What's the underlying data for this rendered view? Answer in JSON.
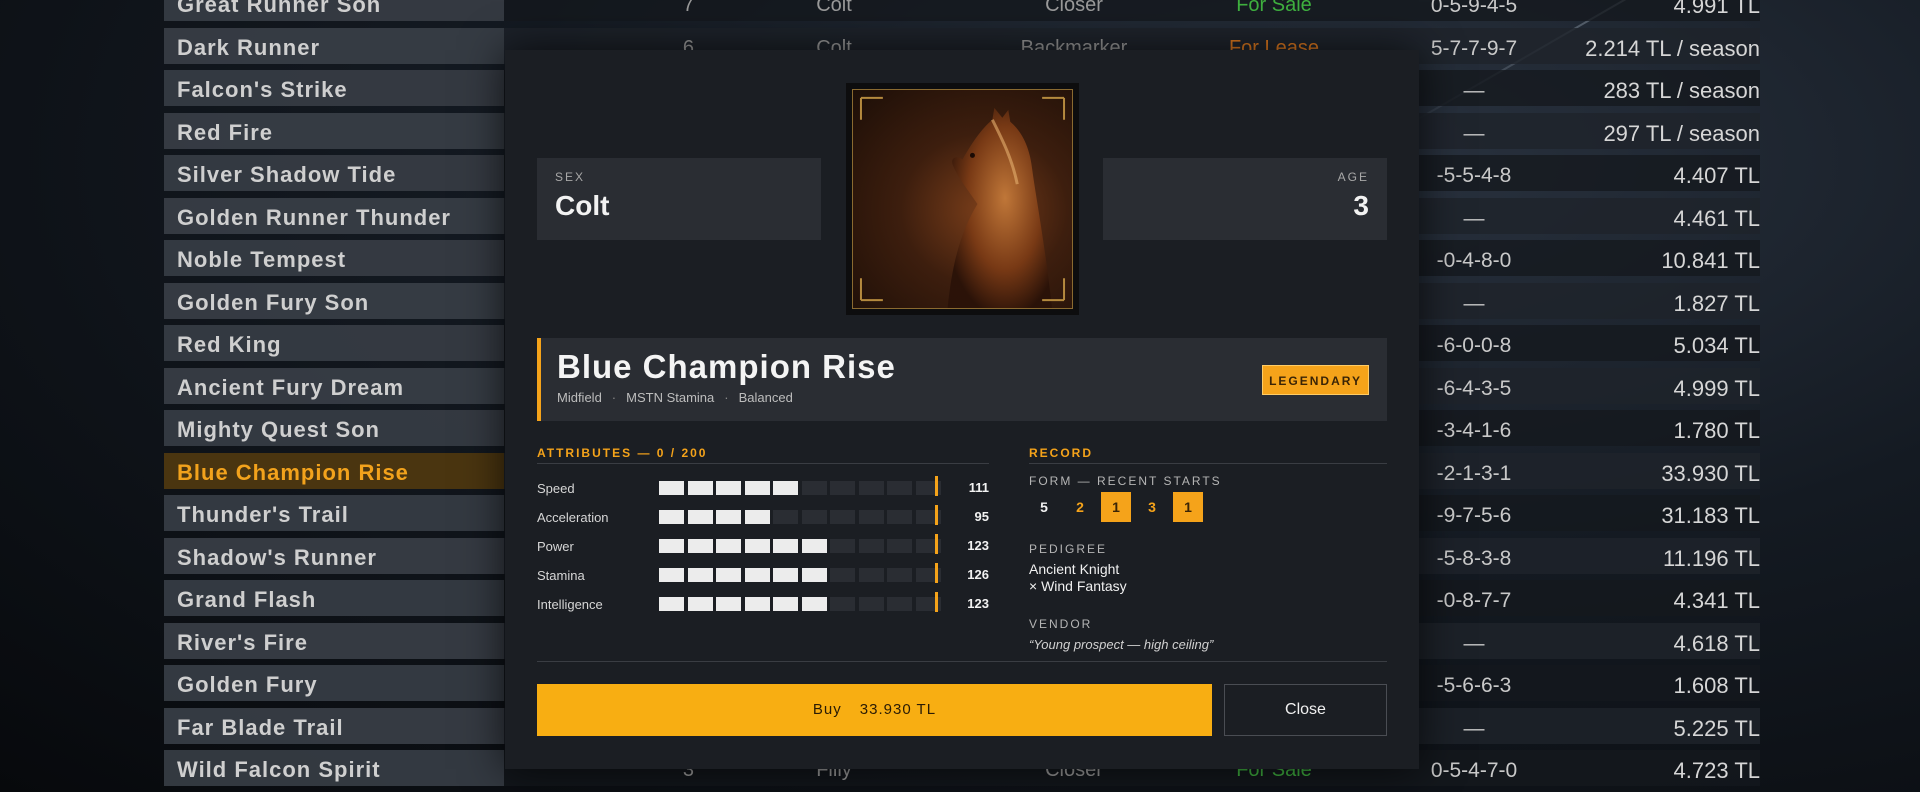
{
  "list": [
    {
      "name": "Great Runner Son",
      "num": "7",
      "sex": "Colt",
      "style": "Closer",
      "status": "For Sale",
      "status_kind": "sale",
      "form": "0-5-9-4-5",
      "price": "4.991 TL"
    },
    {
      "name": "Dark Runner",
      "num": "6",
      "sex": "Colt",
      "style": "Backmarker",
      "status": "For Lease",
      "status_kind": "lease",
      "form": "5-7-7-9-7",
      "price": "2.214 TL / season"
    },
    {
      "name": "Falcon's Strike",
      "num": "",
      "sex": "",
      "style": "",
      "status": "",
      "status_kind": "",
      "form": "—",
      "price": "283 TL / season"
    },
    {
      "name": "Red Fire",
      "num": "",
      "sex": "",
      "style": "",
      "status": "",
      "status_kind": "",
      "form": "—",
      "price": "297 TL / season"
    },
    {
      "name": "Silver Shadow Tide",
      "num": "",
      "sex": "",
      "style": "",
      "status": "",
      "status_kind": "",
      "form": "-5-5-4-8",
      "price": "4.407 TL"
    },
    {
      "name": "Golden Runner Thunder",
      "num": "",
      "sex": "",
      "style": "",
      "status": "",
      "status_kind": "",
      "form": "—",
      "price": "4.461 TL"
    },
    {
      "name": "Noble Tempest",
      "num": "",
      "sex": "",
      "style": "",
      "status": "",
      "status_kind": "",
      "form": "-0-4-8-0",
      "price": "10.841 TL"
    },
    {
      "name": "Golden Fury Son",
      "num": "",
      "sex": "",
      "style": "",
      "status": "",
      "status_kind": "",
      "form": "—",
      "price": "1.827 TL"
    },
    {
      "name": "Red King",
      "num": "",
      "sex": "",
      "style": "",
      "status": "",
      "status_kind": "",
      "form": "-6-0-0-8",
      "price": "5.034 TL"
    },
    {
      "name": "Ancient Fury Dream",
      "num": "",
      "sex": "",
      "style": "",
      "status": "",
      "status_kind": "",
      "form": "-6-4-3-5",
      "price": "4.999 TL"
    },
    {
      "name": "Mighty Quest Son",
      "num": "",
      "sex": "",
      "style": "",
      "status": "",
      "status_kind": "",
      "form": "-3-4-1-6",
      "price": "1.780 TL"
    },
    {
      "name": "Blue Champion Rise",
      "num": "",
      "sex": "",
      "style": "",
      "status": "",
      "status_kind": "",
      "form": "-2-1-3-1",
      "price": "33.930 TL",
      "selected": true
    },
    {
      "name": "Thunder's Trail",
      "num": "",
      "sex": "",
      "style": "",
      "status": "",
      "status_kind": "",
      "form": "-9-7-5-6",
      "price": "31.183 TL"
    },
    {
      "name": "Shadow's Runner",
      "num": "",
      "sex": "",
      "style": "",
      "status": "",
      "status_kind": "",
      "form": "-5-8-3-8",
      "price": "11.196 TL"
    },
    {
      "name": "Grand Flash",
      "num": "",
      "sex": "",
      "style": "",
      "status": "",
      "status_kind": "",
      "form": "-0-8-7-7",
      "price": "4.341 TL"
    },
    {
      "name": "River's Fire",
      "num": "",
      "sex": "",
      "style": "",
      "status": "",
      "status_kind": "",
      "form": "—",
      "price": "4.618 TL"
    },
    {
      "name": "Golden Fury",
      "num": "",
      "sex": "",
      "style": "",
      "status": "",
      "status_kind": "",
      "form": "-5-6-6-3",
      "price": "1.608 TL"
    },
    {
      "name": "Far Blade Trail",
      "num": "",
      "sex": "",
      "style": "",
      "status": "",
      "status_kind": "",
      "form": "—",
      "price": "5.225 TL"
    },
    {
      "name": "Wild Falcon Spirit",
      "num": "3",
      "sex": "Filly",
      "style": "Closer",
      "status": "For Sale",
      "status_kind": "sale",
      "form": "0-5-4-7-0",
      "price": "4.723 TL"
    }
  ],
  "modal": {
    "sex_label": "SEX",
    "sex": "Colt",
    "age_label": "AGE",
    "age": "3",
    "portrait_icon": "horse-portrait",
    "name": "Blue Champion Rise",
    "meta": [
      "Midfield",
      "MSTN Stamina",
      "Balanced"
    ],
    "meta_sep": "·",
    "rarity": "LEGENDARY",
    "attributes_title": "ATTRIBUTES — 0 / 200",
    "attributes": [
      {
        "label": "Speed",
        "value": 111,
        "filled": 5
      },
      {
        "label": "Acceleration",
        "value": 95,
        "filled": 4
      },
      {
        "label": "Power",
        "value": 123,
        "filled": 6
      },
      {
        "label": "Stamina",
        "value": 126,
        "filled": 6
      },
      {
        "label": "Intelligence",
        "value": 123,
        "filled": 6
      }
    ],
    "segments_total": 10,
    "record_title": "RECORD",
    "form_label": "FORM — RECENT STARTS",
    "form": [
      {
        "pos": "5",
        "kind": "plain"
      },
      {
        "pos": "2",
        "kind": "gold"
      },
      {
        "pos": "1",
        "kind": "win"
      },
      {
        "pos": "3",
        "kind": "gold"
      },
      {
        "pos": "1",
        "kind": "win"
      }
    ],
    "pedigree_label": "PEDIGREE",
    "sire": "Ancient Knight",
    "dam": "× Wind Fantasy",
    "vendor_label": "VENDOR",
    "vendor_quote": "“Young prospect — high ceiling”",
    "buy_label": "Buy",
    "buy_price": "33.930 TL",
    "close_label": "Close"
  },
  "colors": {
    "accent": "#f5a31a",
    "sale": "#3fb13f",
    "lease": "#e07a1f"
  }
}
